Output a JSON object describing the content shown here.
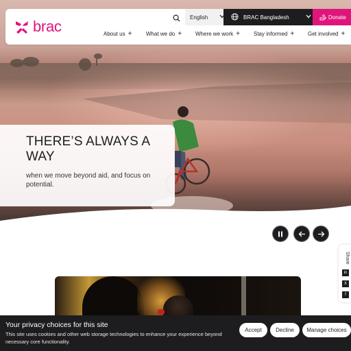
{
  "header": {
    "logo_text": "brac",
    "search_icon": "search-icon",
    "language": "English",
    "country": "BRAC Bangladesh",
    "donate": "Donate",
    "brand_color": "#e0157b",
    "dark_color": "#1d1d1f"
  },
  "nav": {
    "items": [
      {
        "label": "About us"
      },
      {
        "label": "What we do"
      },
      {
        "label": "Where we work"
      },
      {
        "label": "Stay informed"
      },
      {
        "label": "Get involved"
      }
    ],
    "plus": "+"
  },
  "hero": {
    "title": "THERE’S ALWAYS A WAY",
    "subtitle": "when we move beyond aid, and focus on potential."
  },
  "share": {
    "label": "Share",
    "linkedin": "in",
    "x": "X",
    "facebook": "f"
  },
  "cookie": {
    "title": "Your privacy choices for this site",
    "text": "This site uses cookies and other web storage technologies to enhance your experience beyond necessary core functionality.",
    "accept": "Accept",
    "decline": "Decline",
    "manage": "Manage choices"
  }
}
